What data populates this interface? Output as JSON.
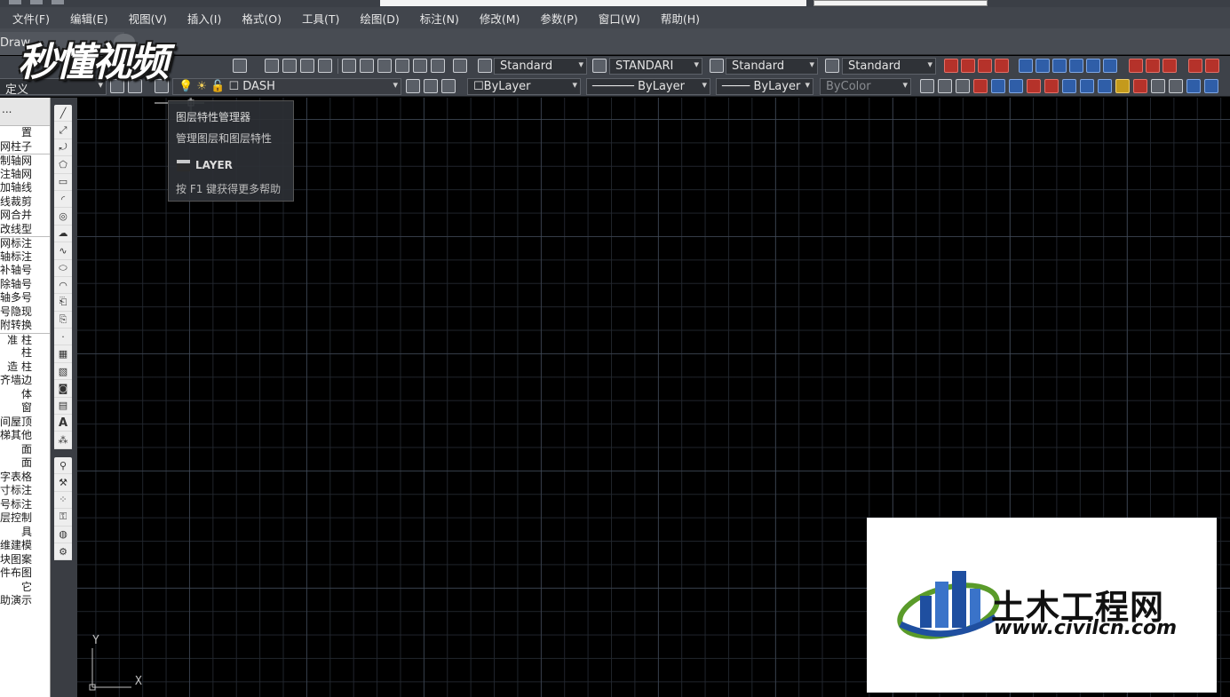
{
  "menu": {
    "items": [
      "文件(F)",
      "编辑(E)",
      "视图(V)",
      "插入(I)",
      "格式(O)",
      "工具(T)",
      "绘图(D)",
      "标注(N)",
      "修改(M)",
      "参数(P)",
      "窗口(W)",
      "帮助(H)"
    ]
  },
  "tabs": {
    "file_tab_label": "Draw"
  },
  "toolbar": {
    "text_style": "Standard",
    "dim_style": "STANDARI",
    "table_style": "Standard",
    "multileader_style": "Standard",
    "workspace": "定义",
    "layer": "DASH",
    "color": "ByLayer",
    "linetype": "ByLayer",
    "lineweight": "ByLayer",
    "plot_style": "ByColor"
  },
  "left_panel": {
    "header": "...",
    "items": [
      "置",
      "网柱子",
      "制轴网",
      "注轴网",
      "加轴线",
      "线裁剪",
      "网合并",
      "改线型",
      "网标注",
      "轴标注",
      "补轴号",
      "除轴号",
      "轴多号",
      "号隐现",
      "附转换",
      "准 柱",
      "柱",
      "造 柱",
      "齐墙边",
      "体",
      "窗",
      "间屋顶",
      "梯其他",
      "面",
      "面",
      "字表格",
      "寸标注",
      "号标注",
      "层控制",
      "具",
      "维建模",
      "块图案",
      "件布图",
      "它",
      "助演示"
    ]
  },
  "tooltip": {
    "title": "图层特性管理器",
    "description": "管理图层和图层特性",
    "command": "LAYER",
    "help": "按 F1 键获得更多帮助"
  },
  "ucs": {
    "x_label": "X",
    "y_label": "Y"
  },
  "watermarks": {
    "top_left": "秒懂视频",
    "civil_title": "土木工程网",
    "civil_url": "www.civilcn.com"
  },
  "colors": {
    "canvas": "#000000",
    "ui_dark": "#3e4249",
    "civil_blue": "#1f4fa0",
    "civil_green": "#5a9b2a"
  }
}
